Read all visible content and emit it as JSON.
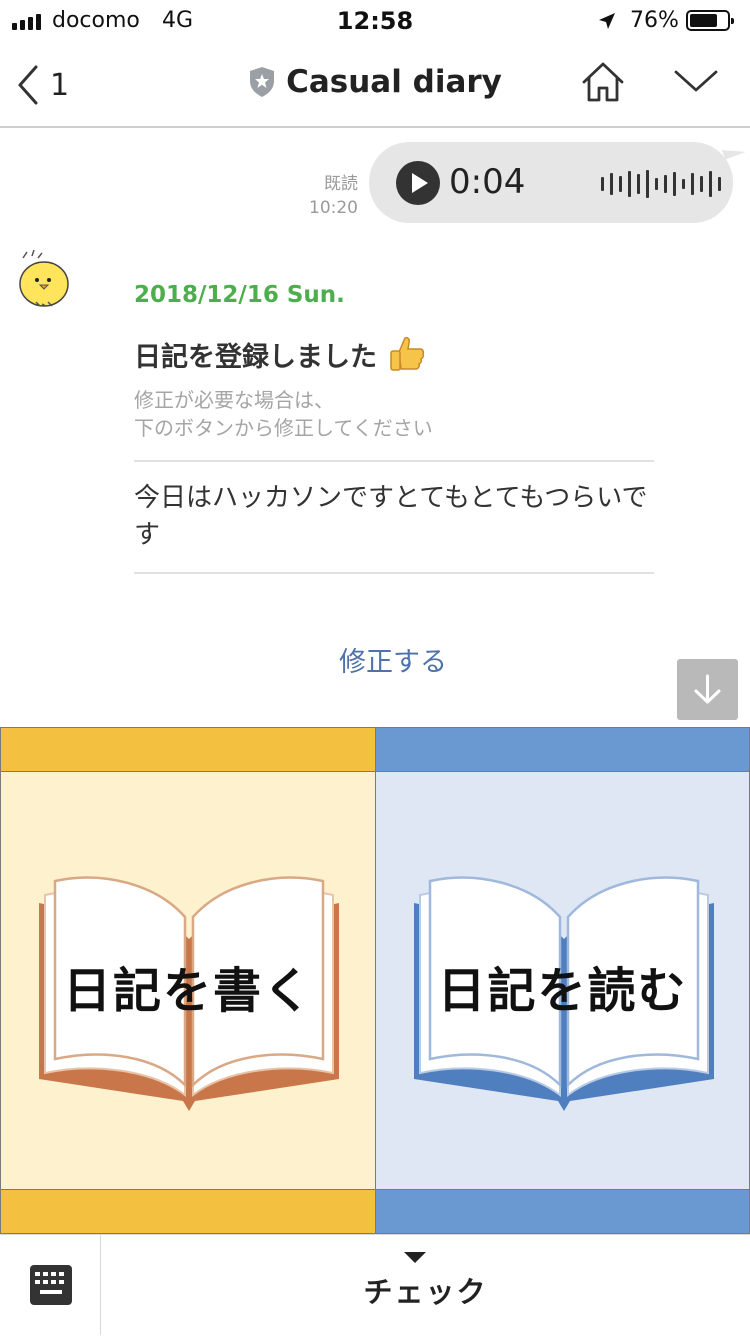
{
  "status_bar": {
    "carrier": "docomo",
    "network": "4G",
    "time": "12:58",
    "battery": "76%",
    "battery_level": 0.76
  },
  "header": {
    "back_count": "1",
    "title": "Casual diary"
  },
  "chat": {
    "read_label": "既読",
    "read_time": "10:20",
    "voice_duration": "0:04",
    "diary": {
      "date": "2018/12/16 Sun.",
      "heading": "日記を登録しました",
      "note_line1": "修正が必要な場合は、",
      "note_line2": "下のボタンから修正してください",
      "entry": "今日はハッカソンですとてもとてもつらいです",
      "edit_label": "修正する"
    }
  },
  "rich_menu": {
    "write_label": "日記を書く",
    "read_label": "日記を読む"
  },
  "bottom_bar": {
    "menu_label": "チェック"
  },
  "colors": {
    "date_green": "#4cae4c",
    "link_blue": "#4f73a8",
    "write_accent": "#f3c03f",
    "read_accent": "#6a98d0"
  },
  "icons": [
    "back-chevron-icon",
    "shield-star-icon",
    "home-icon",
    "chevron-down-icon",
    "play-icon",
    "waveform-icon",
    "chick-avatar-icon",
    "thumbs-up-icon",
    "arrow-down-icon",
    "open-book-icon",
    "keyboard-icon",
    "caret-down-icon"
  ]
}
